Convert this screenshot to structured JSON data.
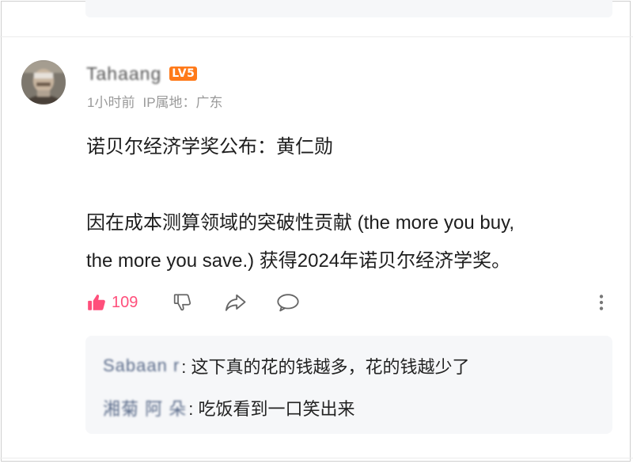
{
  "comment": {
    "username": "Tahaang",
    "level_badge": "LV5",
    "time": "1小时前",
    "ip_location": "IP属地：广东",
    "paragraph1": "诺贝尔经济学奖公布：黄仁勋",
    "paragraph2_line1": "因在成本测算领域的突破性贡献 (the more you buy,",
    "paragraph2_line2": "the more you save.) 获得2024年诺贝尔经济学奖。",
    "like_count": "109"
  },
  "replies": [
    {
      "user": "Sabaan r",
      "text": ": 这下真的花的钱越多，花的钱越少了"
    },
    {
      "user": "湘菊 阿 朵",
      "text": ": 吃饭看到一口笑出来"
    }
  ],
  "icons": {
    "like": "thumbs-up-icon",
    "dislike": "thumbs-down-icon",
    "share": "share-icon",
    "comment": "comment-icon",
    "more": "more-vertical-icon"
  },
  "colors": {
    "like_accent": "#ff4f7b",
    "level_badge": "#ff7a1a",
    "reply_background": "#f6f7f9"
  }
}
